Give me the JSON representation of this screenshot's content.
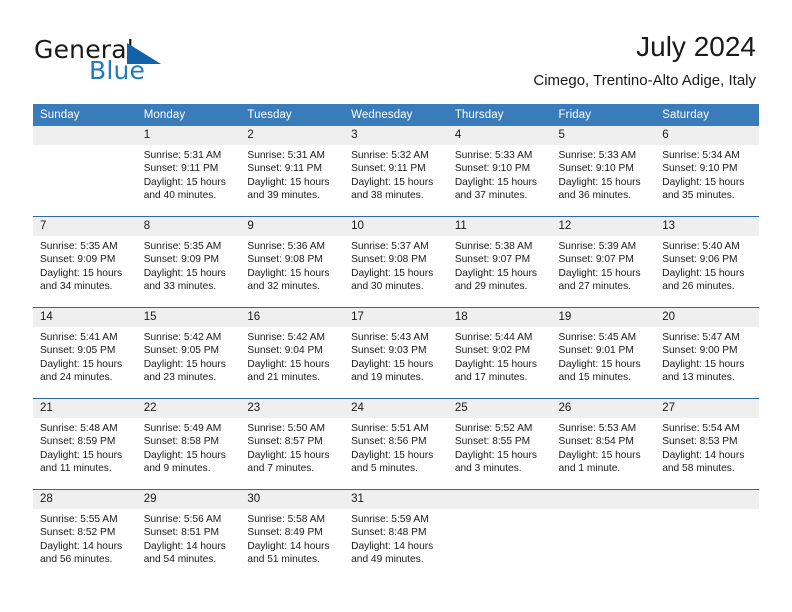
{
  "brand": {
    "name_part1": "General",
    "name_part2": "Blue",
    "triangle_color": "#1361a8",
    "blue_color": "#1f7ac0"
  },
  "header": {
    "title": "July 2024",
    "subtitle": "Cimego, Trentino-Alto Adige, Italy"
  },
  "theme": {
    "header_row_bg": "#3a7cba",
    "week_divider": "#2a6aa8",
    "daynum_band_bg": "#efefef",
    "text_color": "#1a1a1a"
  },
  "weekdays": [
    {
      "label": "Sunday"
    },
    {
      "label": "Monday"
    },
    {
      "label": "Tuesday"
    },
    {
      "label": "Wednesday"
    },
    {
      "label": "Thursday"
    },
    {
      "label": "Friday"
    },
    {
      "label": "Saturday"
    }
  ],
  "weeks": [
    {
      "days": [
        {
          "num": "",
          "sunrise": "",
          "sunset": "",
          "daylight_line1": "",
          "daylight_line2": "",
          "empty": true
        },
        {
          "num": "1",
          "sunrise": "Sunrise: 5:31 AM",
          "sunset": "Sunset: 9:11 PM",
          "daylight_line1": "Daylight: 15 hours",
          "daylight_line2": "and 40 minutes."
        },
        {
          "num": "2",
          "sunrise": "Sunrise: 5:31 AM",
          "sunset": "Sunset: 9:11 PM",
          "daylight_line1": "Daylight: 15 hours",
          "daylight_line2": "and 39 minutes."
        },
        {
          "num": "3",
          "sunrise": "Sunrise: 5:32 AM",
          "sunset": "Sunset: 9:11 PM",
          "daylight_line1": "Daylight: 15 hours",
          "daylight_line2": "and 38 minutes."
        },
        {
          "num": "4",
          "sunrise": "Sunrise: 5:33 AM",
          "sunset": "Sunset: 9:10 PM",
          "daylight_line1": "Daylight: 15 hours",
          "daylight_line2": "and 37 minutes."
        },
        {
          "num": "5",
          "sunrise": "Sunrise: 5:33 AM",
          "sunset": "Sunset: 9:10 PM",
          "daylight_line1": "Daylight: 15 hours",
          "daylight_line2": "and 36 minutes."
        },
        {
          "num": "6",
          "sunrise": "Sunrise: 5:34 AM",
          "sunset": "Sunset: 9:10 PM",
          "daylight_line1": "Daylight: 15 hours",
          "daylight_line2": "and 35 minutes."
        }
      ]
    },
    {
      "days": [
        {
          "num": "7",
          "sunrise": "Sunrise: 5:35 AM",
          "sunset": "Sunset: 9:09 PM",
          "daylight_line1": "Daylight: 15 hours",
          "daylight_line2": "and 34 minutes."
        },
        {
          "num": "8",
          "sunrise": "Sunrise: 5:35 AM",
          "sunset": "Sunset: 9:09 PM",
          "daylight_line1": "Daylight: 15 hours",
          "daylight_line2": "and 33 minutes."
        },
        {
          "num": "9",
          "sunrise": "Sunrise: 5:36 AM",
          "sunset": "Sunset: 9:08 PM",
          "daylight_line1": "Daylight: 15 hours",
          "daylight_line2": "and 32 minutes."
        },
        {
          "num": "10",
          "sunrise": "Sunrise: 5:37 AM",
          "sunset": "Sunset: 9:08 PM",
          "daylight_line1": "Daylight: 15 hours",
          "daylight_line2": "and 30 minutes."
        },
        {
          "num": "11",
          "sunrise": "Sunrise: 5:38 AM",
          "sunset": "Sunset: 9:07 PM",
          "daylight_line1": "Daylight: 15 hours",
          "daylight_line2": "and 29 minutes."
        },
        {
          "num": "12",
          "sunrise": "Sunrise: 5:39 AM",
          "sunset": "Sunset: 9:07 PM",
          "daylight_line1": "Daylight: 15 hours",
          "daylight_line2": "and 27 minutes."
        },
        {
          "num": "13",
          "sunrise": "Sunrise: 5:40 AM",
          "sunset": "Sunset: 9:06 PM",
          "daylight_line1": "Daylight: 15 hours",
          "daylight_line2": "and 26 minutes."
        }
      ]
    },
    {
      "days": [
        {
          "num": "14",
          "sunrise": "Sunrise: 5:41 AM",
          "sunset": "Sunset: 9:05 PM",
          "daylight_line1": "Daylight: 15 hours",
          "daylight_line2": "and 24 minutes."
        },
        {
          "num": "15",
          "sunrise": "Sunrise: 5:42 AM",
          "sunset": "Sunset: 9:05 PM",
          "daylight_line1": "Daylight: 15 hours",
          "daylight_line2": "and 23 minutes."
        },
        {
          "num": "16",
          "sunrise": "Sunrise: 5:42 AM",
          "sunset": "Sunset: 9:04 PM",
          "daylight_line1": "Daylight: 15 hours",
          "daylight_line2": "and 21 minutes."
        },
        {
          "num": "17",
          "sunrise": "Sunrise: 5:43 AM",
          "sunset": "Sunset: 9:03 PM",
          "daylight_line1": "Daylight: 15 hours",
          "daylight_line2": "and 19 minutes."
        },
        {
          "num": "18",
          "sunrise": "Sunrise: 5:44 AM",
          "sunset": "Sunset: 9:02 PM",
          "daylight_line1": "Daylight: 15 hours",
          "daylight_line2": "and 17 minutes."
        },
        {
          "num": "19",
          "sunrise": "Sunrise: 5:45 AM",
          "sunset": "Sunset: 9:01 PM",
          "daylight_line1": "Daylight: 15 hours",
          "daylight_line2": "and 15 minutes."
        },
        {
          "num": "20",
          "sunrise": "Sunrise: 5:47 AM",
          "sunset": "Sunset: 9:00 PM",
          "daylight_line1": "Daylight: 15 hours",
          "daylight_line2": "and 13 minutes."
        }
      ]
    },
    {
      "days": [
        {
          "num": "21",
          "sunrise": "Sunrise: 5:48 AM",
          "sunset": "Sunset: 8:59 PM",
          "daylight_line1": "Daylight: 15 hours",
          "daylight_line2": "and 11 minutes."
        },
        {
          "num": "22",
          "sunrise": "Sunrise: 5:49 AM",
          "sunset": "Sunset: 8:58 PM",
          "daylight_line1": "Daylight: 15 hours",
          "daylight_line2": "and 9 minutes."
        },
        {
          "num": "23",
          "sunrise": "Sunrise: 5:50 AM",
          "sunset": "Sunset: 8:57 PM",
          "daylight_line1": "Daylight: 15 hours",
          "daylight_line2": "and 7 minutes."
        },
        {
          "num": "24",
          "sunrise": "Sunrise: 5:51 AM",
          "sunset": "Sunset: 8:56 PM",
          "daylight_line1": "Daylight: 15 hours",
          "daylight_line2": "and 5 minutes."
        },
        {
          "num": "25",
          "sunrise": "Sunrise: 5:52 AM",
          "sunset": "Sunset: 8:55 PM",
          "daylight_line1": "Daylight: 15 hours",
          "daylight_line2": "and 3 minutes."
        },
        {
          "num": "26",
          "sunrise": "Sunrise: 5:53 AM",
          "sunset": "Sunset: 8:54 PM",
          "daylight_line1": "Daylight: 15 hours",
          "daylight_line2": "and 1 minute."
        },
        {
          "num": "27",
          "sunrise": "Sunrise: 5:54 AM",
          "sunset": "Sunset: 8:53 PM",
          "daylight_line1": "Daylight: 14 hours",
          "daylight_line2": "and 58 minutes."
        }
      ]
    },
    {
      "days": [
        {
          "num": "28",
          "sunrise": "Sunrise: 5:55 AM",
          "sunset": "Sunset: 8:52 PM",
          "daylight_line1": "Daylight: 14 hours",
          "daylight_line2": "and 56 minutes."
        },
        {
          "num": "29",
          "sunrise": "Sunrise: 5:56 AM",
          "sunset": "Sunset: 8:51 PM",
          "daylight_line1": "Daylight: 14 hours",
          "daylight_line2": "and 54 minutes."
        },
        {
          "num": "30",
          "sunrise": "Sunrise: 5:58 AM",
          "sunset": "Sunset: 8:49 PM",
          "daylight_line1": "Daylight: 14 hours",
          "daylight_line2": "and 51 minutes."
        },
        {
          "num": "31",
          "sunrise": "Sunrise: 5:59 AM",
          "sunset": "Sunset: 8:48 PM",
          "daylight_line1": "Daylight: 14 hours",
          "daylight_line2": "and 49 minutes."
        },
        {
          "num": "",
          "sunrise": "",
          "sunset": "",
          "daylight_line1": "",
          "daylight_line2": "",
          "empty": true
        },
        {
          "num": "",
          "sunrise": "",
          "sunset": "",
          "daylight_line1": "",
          "daylight_line2": "",
          "empty": true
        },
        {
          "num": "",
          "sunrise": "",
          "sunset": "",
          "daylight_line1": "",
          "daylight_line2": "",
          "empty": true
        }
      ]
    }
  ]
}
